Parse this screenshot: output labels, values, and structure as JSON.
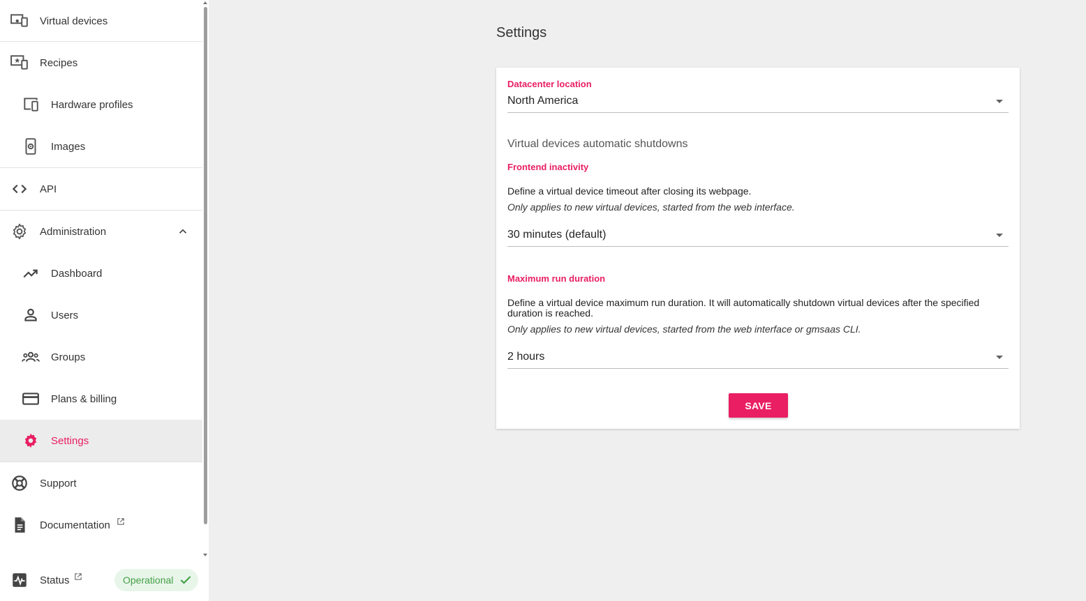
{
  "sidebar": {
    "items": [
      {
        "label": "Virtual devices",
        "icon": "virtual-devices-icon"
      },
      {
        "label": "Recipes",
        "icon": "recipes-icon"
      },
      {
        "label": "Hardware profiles",
        "icon": "hardware-profiles-icon"
      },
      {
        "label": "Images",
        "icon": "images-icon"
      },
      {
        "label": "API",
        "icon": "code-icon"
      },
      {
        "label": "Administration",
        "icon": "gear-icon"
      },
      {
        "label": "Dashboard",
        "icon": "trending-up-icon"
      },
      {
        "label": "Users",
        "icon": "user-icon"
      },
      {
        "label": "Groups",
        "icon": "group-icon"
      },
      {
        "label": "Plans & billing",
        "icon": "credit-card-icon"
      },
      {
        "label": "Settings",
        "icon": "gear-icon",
        "active": true
      },
      {
        "label": "Support",
        "icon": "lifebuoy-icon"
      },
      {
        "label": "Documentation",
        "icon": "document-icon"
      },
      {
        "label": "Status",
        "icon": "pulse-icon"
      }
    ],
    "status_badge": "Operational"
  },
  "page": {
    "title": "Settings"
  },
  "settings": {
    "datacenter": {
      "label": "Datacenter location",
      "value": "North America"
    },
    "shutdown_heading": "Virtual devices automatic shutdowns",
    "frontend_inactivity": {
      "label": "Frontend inactivity",
      "description": "Define a virtual device timeout after closing its webpage.",
      "note": "Only applies to new virtual devices, started from the web interface.",
      "value": "30 minutes (default)"
    },
    "max_run_duration": {
      "label": "Maximum run duration",
      "description": "Define a virtual device maximum run duration. It will automatically shutdown virtual devices after the specified duration is reached.",
      "note": "Only applies to new virtual devices, started from the web interface or gmsaas CLI.",
      "value": "2 hours"
    },
    "save_label": "SAVE"
  },
  "colors": {
    "accent": "#e91e63",
    "status_green": "#43a047",
    "status_bg": "#e8f5e9",
    "background": "#efefef"
  }
}
